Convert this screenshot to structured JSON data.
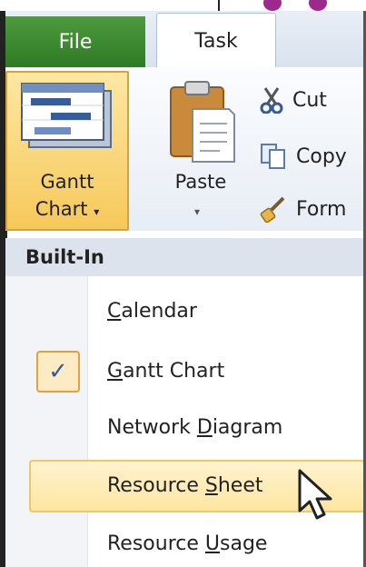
{
  "ribbon": {
    "tabs": [
      {
        "label": "File"
      },
      {
        "label": "Task"
      }
    ],
    "gantt_chart_button": {
      "line1": "Gantt",
      "line2": "Chart"
    },
    "paste_button": {
      "label": "Paste"
    },
    "clipboard": {
      "cut": "Cut",
      "copy": "Copy",
      "format": "Form"
    }
  },
  "menu": {
    "header": "Built-In",
    "items": [
      {
        "prefix": "",
        "accel": "C",
        "suffix": "alendar"
      },
      {
        "prefix": "",
        "accel": "G",
        "suffix": "antt Chart",
        "checked": true
      },
      {
        "prefix": "Network ",
        "accel": "D",
        "suffix": "iagram"
      },
      {
        "prefix": "Resource ",
        "accel": "S",
        "suffix": "heet",
        "hovered": true
      },
      {
        "prefix": "Resource ",
        "accel": "U",
        "suffix": "sage"
      }
    ],
    "check_glyph": "✓"
  },
  "colors": {
    "file_tab": "#2e7b25",
    "highlight": "#f6c85a",
    "menu_header": "#dde3ec"
  }
}
